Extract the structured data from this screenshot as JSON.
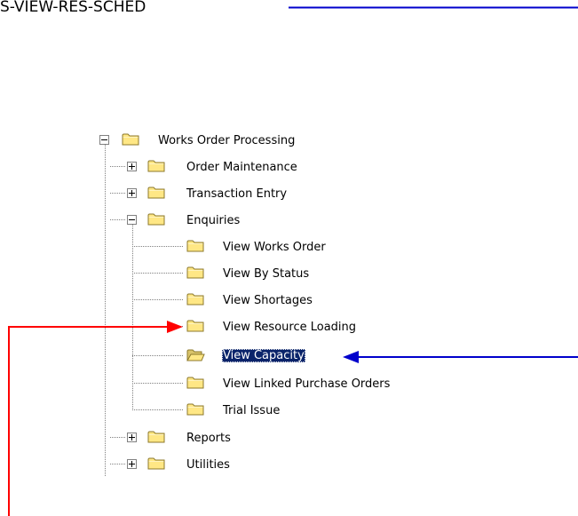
{
  "header": {
    "label": "S-VIEW-RES-SCHED"
  },
  "tree": {
    "root": {
      "label": "Works Order Processing",
      "expanded": true
    },
    "items": [
      {
        "label": "Order Maintenance",
        "expanded": false
      },
      {
        "label": "Transaction Entry",
        "expanded": false
      },
      {
        "label": "Enquiries",
        "expanded": true
      },
      {
        "label": "Reports",
        "expanded": false
      },
      {
        "label": "Utilities",
        "expanded": false
      }
    ],
    "enquiries": [
      {
        "label": "View Works Order"
      },
      {
        "label": "View By Status"
      },
      {
        "label": "View Shortages"
      },
      {
        "label": "View Resource Loading"
      },
      {
        "label": "View Capacity",
        "selected": true,
        "open": true
      },
      {
        "label": "View Linked Purchase Orders"
      },
      {
        "label": "Trial Issue"
      }
    ]
  },
  "colors": {
    "selection_bg": "#0a246a",
    "callout_blue": "#0000cc",
    "callout_red": "#ff0000",
    "folder_fill": "#ffe785",
    "folder_stroke": "#8c7a2c"
  }
}
